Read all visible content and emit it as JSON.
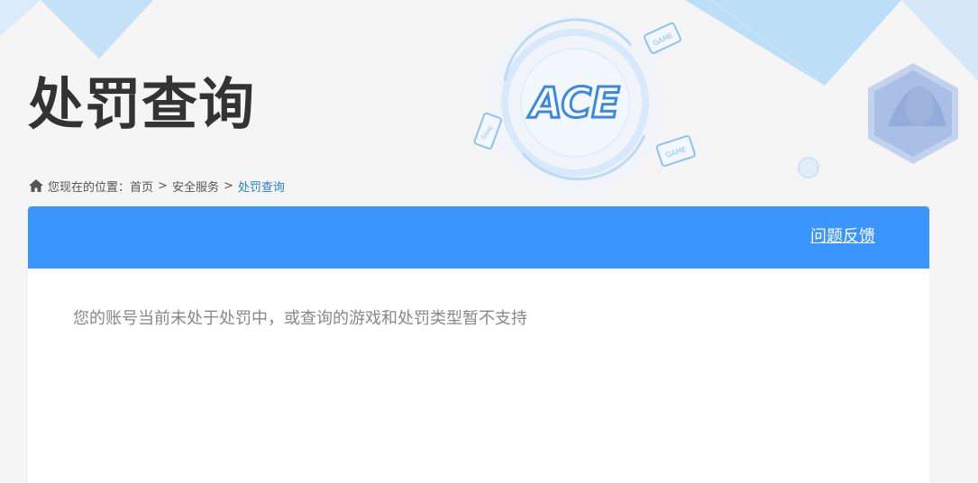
{
  "header": {
    "title": "处罚查询",
    "logo_text": "ACE",
    "game_tag": "GAME"
  },
  "breadcrumb": {
    "prefix": "您现在的位置：",
    "items": [
      "首页",
      "安全服务"
    ],
    "separator": ">",
    "current": "处罚查询"
  },
  "toolbar": {
    "feedback_label": "问题反馈"
  },
  "main": {
    "message": "您的账号当前未处于处罚中，或查询的游戏和处罚类型暂不支持"
  },
  "colors": {
    "accent": "#3a95ff",
    "title": "#333333",
    "message": "#888888",
    "background": "#f5f5f5"
  }
}
